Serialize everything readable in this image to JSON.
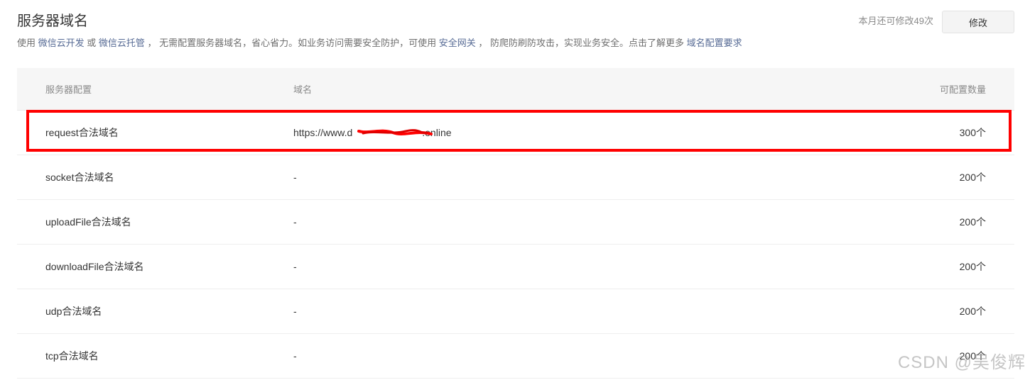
{
  "header": {
    "title": "服务器域名",
    "quota_text": "本月还可修改49次",
    "modify_label": "修改"
  },
  "description": {
    "t1": "使用 ",
    "link1": "微信云开发",
    "t2": " 或 ",
    "link2": "微信云托管",
    "t3": " ， 无需配置服务器域名，省心省力。如业务访问需要安全防护，可使用 ",
    "link3": "安全网关",
    "t4": " ， 防爬防刷防攻击，实现业务安全。点击了解更多 ",
    "link4": "域名配置要求"
  },
  "table": {
    "headers": {
      "config": "服务器配置",
      "domain": "域名",
      "count": "可配置数量"
    },
    "rows": [
      {
        "config": "request合法域名",
        "domain": "https://www.d       .online",
        "count": "300个"
      },
      {
        "config": "socket合法域名",
        "domain": "-",
        "count": "200个"
      },
      {
        "config": "uploadFile合法域名",
        "domain": "-",
        "count": "200个"
      },
      {
        "config": "downloadFile合法域名",
        "domain": "-",
        "count": "200个"
      },
      {
        "config": "udp合法域名",
        "domain": "-",
        "count": "200个"
      },
      {
        "config": "tcp合法域名",
        "domain": "-",
        "count": "200个"
      }
    ]
  },
  "watermark": "CSDN @吴俊辉",
  "colors": {
    "link": "#576b95",
    "highlight": "#ff0000",
    "header_bg": "#f6f6f6"
  }
}
